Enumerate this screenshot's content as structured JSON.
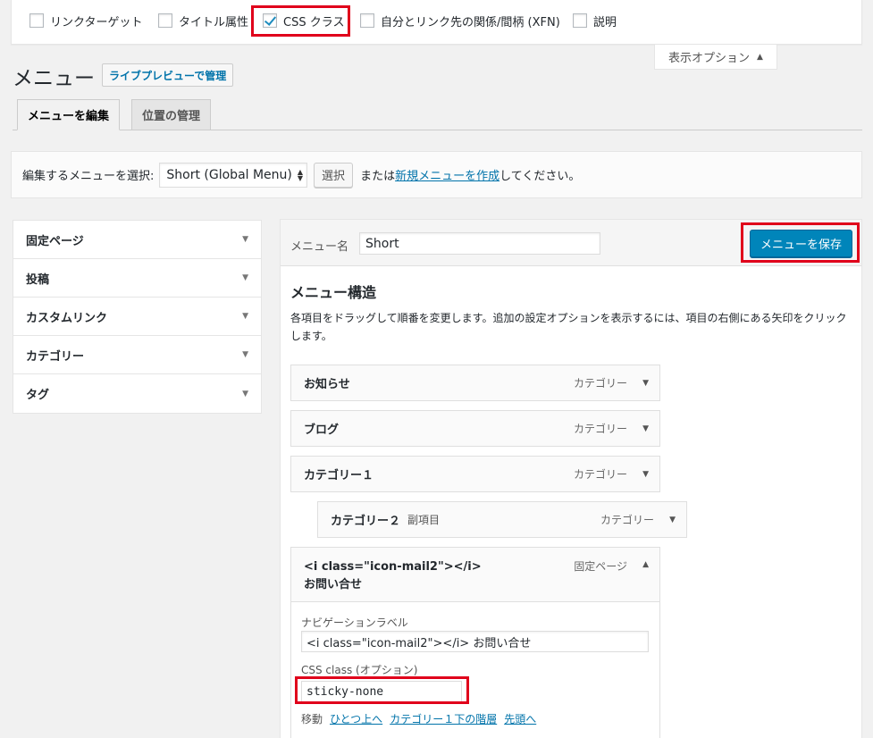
{
  "screen_options": {
    "items": [
      {
        "label": "リンクターゲット",
        "checked": false
      },
      {
        "label": "タイトル属性",
        "checked": false
      },
      {
        "label": "CSS クラス",
        "checked": true
      },
      {
        "label": "自分とリンク先の関係/間柄 (XFN)",
        "checked": false
      },
      {
        "label": "説明",
        "checked": false
      }
    ],
    "tab_label": "表示オプション"
  },
  "header": {
    "title": "メニュー",
    "action_label": "ライブプレビューで管理"
  },
  "tabs": [
    {
      "label": "メニューを編集",
      "active": true
    },
    {
      "label": "位置の管理",
      "active": false
    }
  ],
  "manage": {
    "prompt": "編集するメニューを選択:",
    "selected_menu": "Short (Global Menu)",
    "select_button": "選択",
    "or_text": "または",
    "create_link": "新規メニューを作成",
    "suffix": "してください。"
  },
  "sidebar": {
    "sections": [
      {
        "label": "固定ページ"
      },
      {
        "label": "投稿"
      },
      {
        "label": "カスタムリンク"
      },
      {
        "label": "カテゴリー"
      },
      {
        "label": "タグ"
      }
    ]
  },
  "menu_editor": {
    "name_label": "メニュー名",
    "name_value": "Short",
    "save_button": "メニューを保存",
    "structure_title": "メニュー構造",
    "structure_desc": "各項目をドラッグして順番を変更します。追加の設定オプションを表示するには、項目の右側にある矢印をクリックします。",
    "items": [
      {
        "title": "お知らせ",
        "type": "カテゴリー",
        "sub_label": ""
      },
      {
        "title": "ブログ",
        "type": "カテゴリー",
        "sub_label": ""
      },
      {
        "title": "カテゴリー１",
        "type": "カテゴリー",
        "sub_label": ""
      },
      {
        "title": "カテゴリー２",
        "type": "カテゴリー",
        "sub_label": "副項目"
      }
    ],
    "open_item": {
      "title": "<i class=\"icon-mail2\"></i> お問い合せ",
      "type": "固定ページ",
      "nav_label_caption": "ナビゲーションラベル",
      "nav_label_value": "<i class=\"icon-mail2\"></i> お問い合せ",
      "css_caption": "CSS class (オプション)",
      "css_value": "sticky-none",
      "move_label": "移動",
      "move_links": [
        "ひとつ上へ",
        "カテゴリー１下の階層",
        "先頭へ"
      ]
    }
  },
  "colors": {
    "highlight": "#e0001b",
    "primary": "#0085ba",
    "link": "#0073aa"
  }
}
